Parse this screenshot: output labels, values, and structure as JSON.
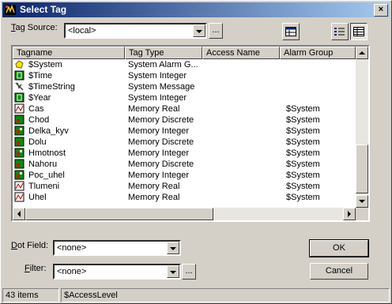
{
  "window": {
    "title": "Select Tag",
    "close_label": "×"
  },
  "tag_source": {
    "label_prefix": "T",
    "label_rest": "ag Source:",
    "value": "<local>"
  },
  "dot_field": {
    "label_prefix": "D",
    "label_rest": "ot Field:",
    "value": "<none>"
  },
  "filter": {
    "label_prefix": "F",
    "label_rest": "ilter:",
    "value": "<none>"
  },
  "buttons": {
    "browse": "...",
    "ok": "OK",
    "cancel": "Cancel",
    "filter_browse": "..."
  },
  "columns": [
    "Tagname",
    "Tag Type",
    "Access Name",
    "Alarm Group"
  ],
  "rows": [
    {
      "icon": "system-alarm-icon",
      "name": "$System",
      "type": "System Alarm G...",
      "access": "",
      "alarm": ""
    },
    {
      "icon": "system-integer-icon",
      "name": "$Time",
      "type": "System Integer",
      "access": "",
      "alarm": ""
    },
    {
      "icon": "system-message-icon",
      "name": "$TimeString",
      "type": "System Message",
      "access": "",
      "alarm": ""
    },
    {
      "icon": "system-integer-icon",
      "name": "$Year",
      "type": "System Integer",
      "access": "",
      "alarm": ""
    },
    {
      "icon": "memory-real-icon",
      "name": "Cas",
      "type": "Memory Real",
      "access": "",
      "alarm": "$System"
    },
    {
      "icon": "memory-discrete-icon",
      "name": "Chod",
      "type": "Memory Discrete",
      "access": "",
      "alarm": "$System"
    },
    {
      "icon": "memory-integer-icon",
      "name": "Delka_kyv",
      "type": "Memory Integer",
      "access": "",
      "alarm": "$System"
    },
    {
      "icon": "memory-discrete-icon",
      "name": "Dolu",
      "type": "Memory Discrete",
      "access": "",
      "alarm": "$System"
    },
    {
      "icon": "memory-integer-icon",
      "name": "Hmotnost",
      "type": "Memory Integer",
      "access": "",
      "alarm": "$System"
    },
    {
      "icon": "memory-discrete-icon",
      "name": "Nahoru",
      "type": "Memory Discrete",
      "access": "",
      "alarm": "$System"
    },
    {
      "icon": "memory-integer-icon",
      "name": "Poc_uhel",
      "type": "Memory Integer",
      "access": "",
      "alarm": "$System"
    },
    {
      "icon": "memory-real-icon",
      "name": "Tlumeni",
      "type": "Memory Real",
      "access": "",
      "alarm": "$System"
    },
    {
      "icon": "memory-real-icon",
      "name": "Uhel",
      "type": "Memory Real",
      "access": "",
      "alarm": "$System"
    }
  ],
  "status": {
    "count": "43 items",
    "field": "$AccessLevel"
  }
}
